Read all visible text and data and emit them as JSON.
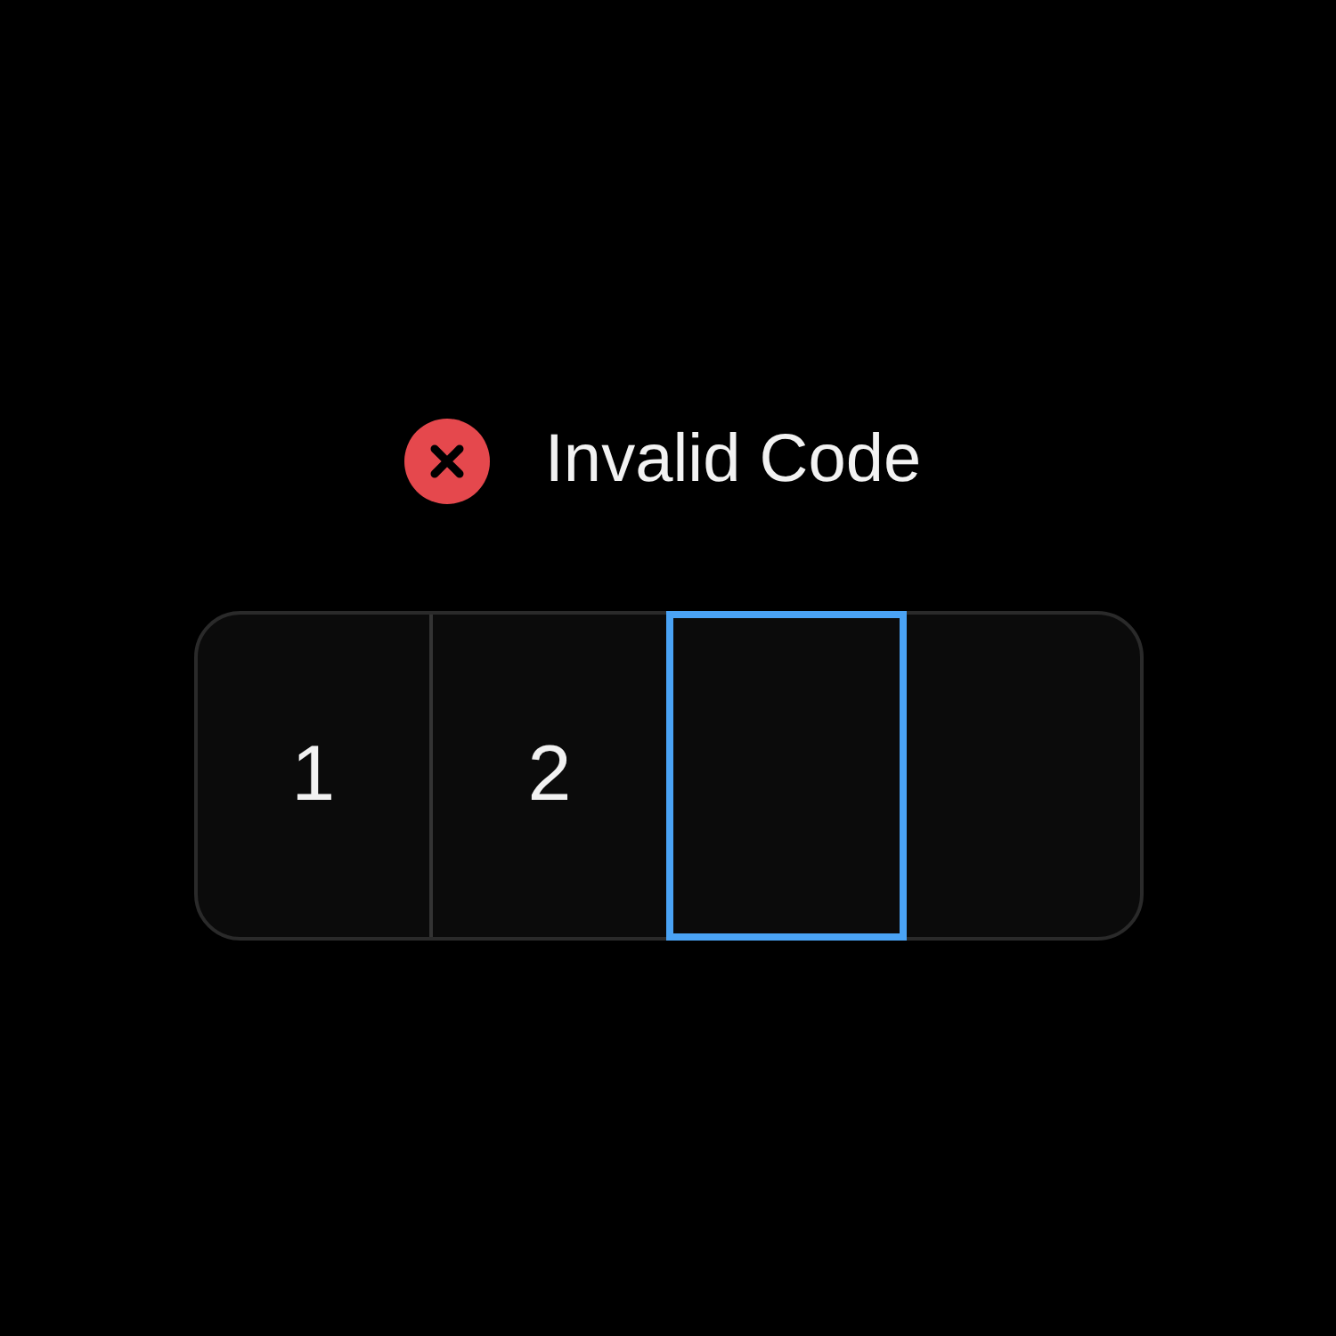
{
  "message": {
    "kind": "error",
    "text": "Invalid Code"
  },
  "slots": [
    {
      "value": "1",
      "selected": false
    },
    {
      "value": "2",
      "selected": false
    },
    {
      "selected": true
    },
    {
      "selected": false
    }
  ]
}
